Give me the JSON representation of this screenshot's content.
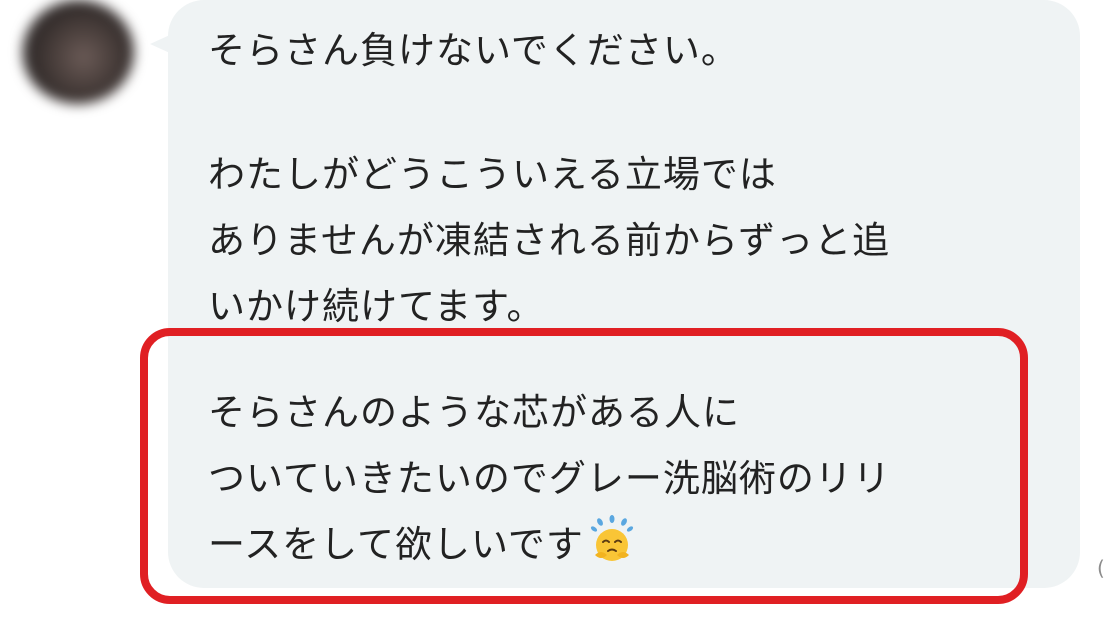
{
  "message": {
    "paragraphs": [
      [
        "そらさん負けないでください。"
      ],
      [
        "わたしがどうこういえる立場では",
        "ありませんが凍結される前からずっと追",
        "いかけ続けてます。"
      ],
      [
        "そらさんのような芯がある人に",
        "ついていきたいのでグレー洗脳術のリリ",
        "ースをして欲しいです"
      ]
    ],
    "emoji": "pleading-sweat-emoji"
  },
  "timestamp_fragment": "(",
  "colors": {
    "bubble": "#eff3f4",
    "highlight": "#e01f23",
    "text": "#222222"
  }
}
